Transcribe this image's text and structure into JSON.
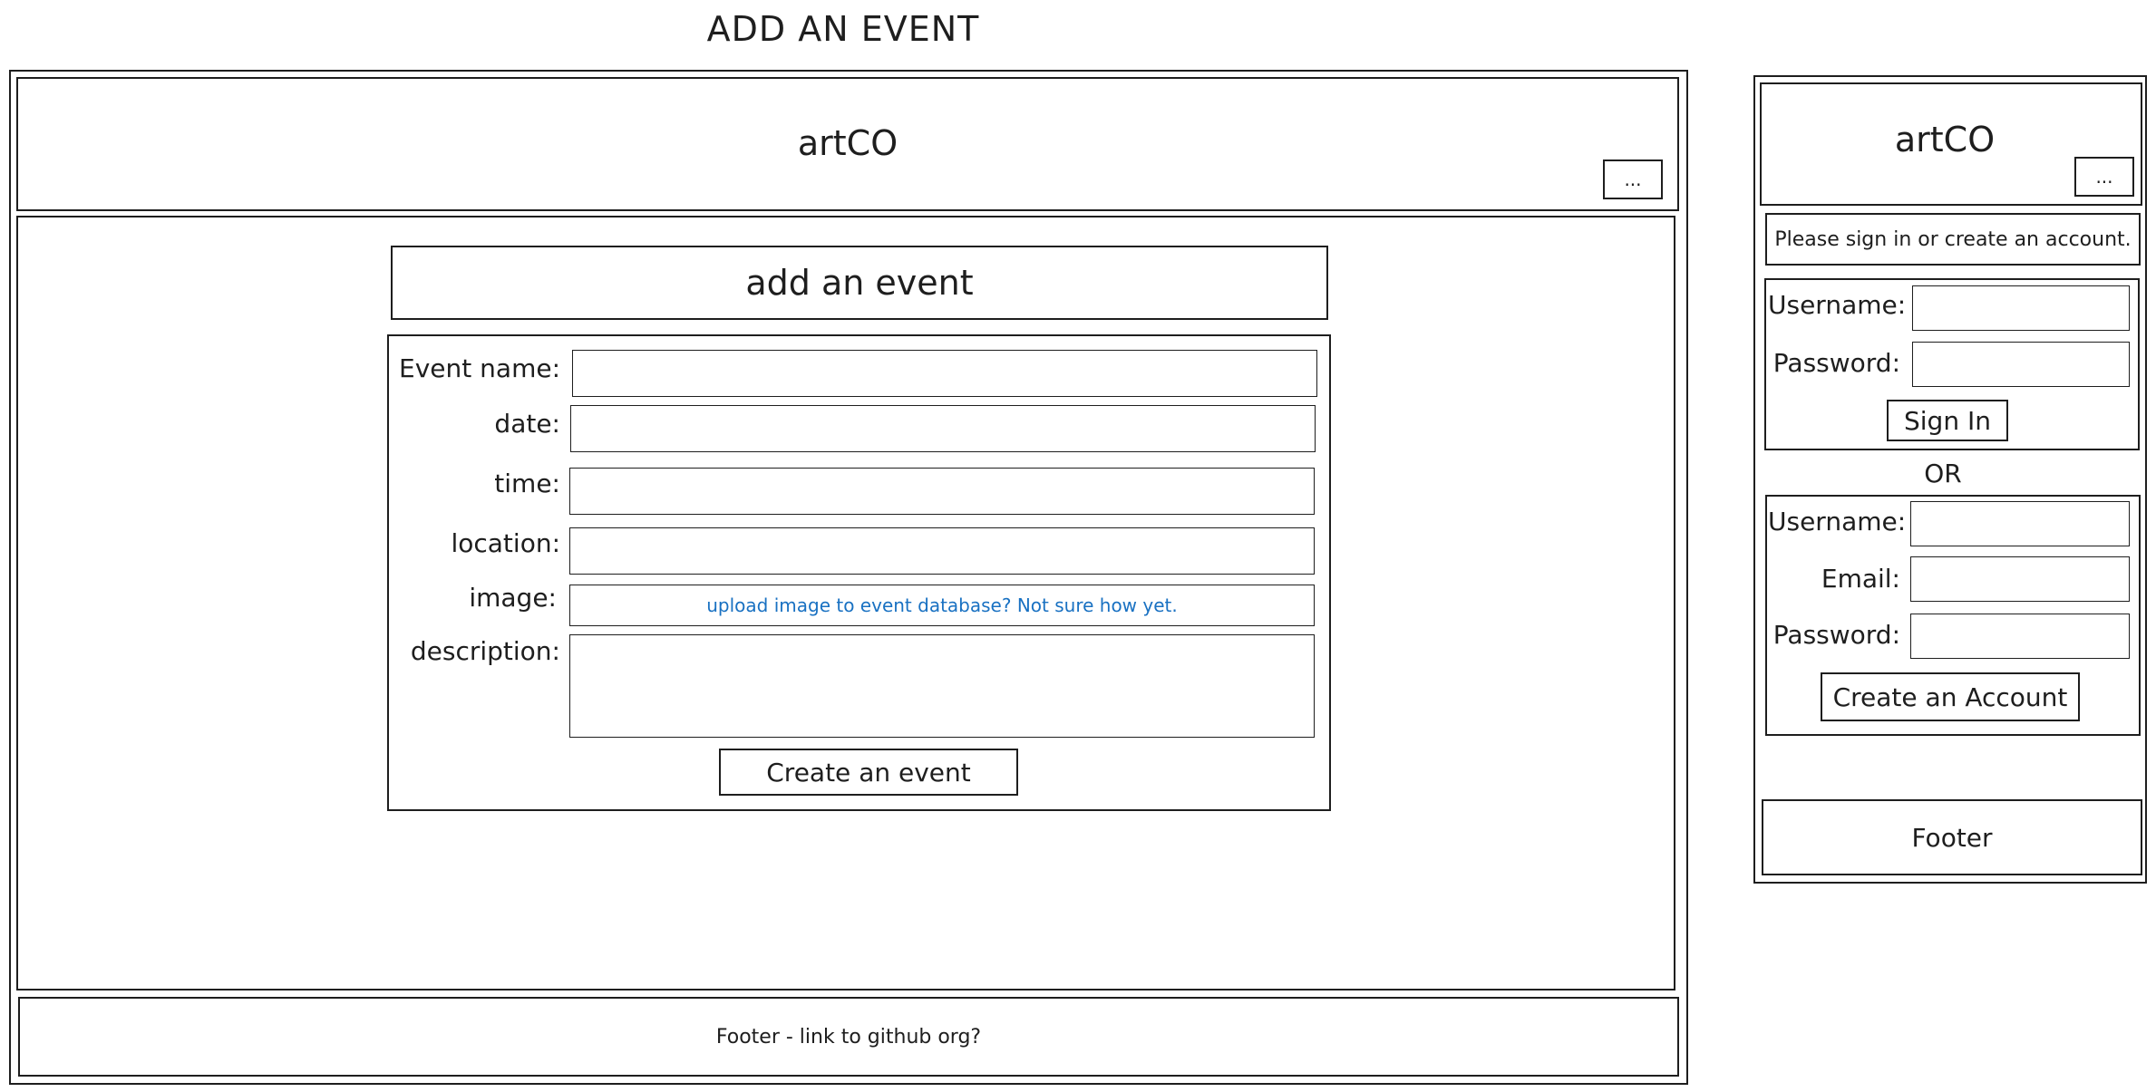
{
  "page": {
    "title": "ADD AN EVENT"
  },
  "desktop": {
    "header": {
      "brand": "artCO",
      "menu_label": "..."
    },
    "heading": "add an event",
    "form": {
      "event_name_label": "Event name:",
      "date_label": "date:",
      "time_label": "time:",
      "location_label": "location:",
      "image_label": "image:",
      "image_note": "upload image to event database? Not sure how yet.",
      "description_label": "description:",
      "submit_label": "Create an event"
    },
    "footer": {
      "text": "Footer - link to github org?"
    }
  },
  "mobile": {
    "header": {
      "brand": "artCO",
      "menu_label": "..."
    },
    "notice": "Please sign in or create an account.",
    "signin": {
      "username_label": "Username:",
      "password_label": "Password:",
      "submit_label": "Sign In"
    },
    "or_label": "OR",
    "signup": {
      "username_label": "Username:",
      "email_label": "Email:",
      "password_label": "Password:",
      "submit_label": "Create an Account"
    },
    "footer": {
      "text": "Footer"
    }
  },
  "colors": {
    "ink": "#1e1e1e",
    "link": "#1971c2",
    "background": "#ffffff"
  }
}
